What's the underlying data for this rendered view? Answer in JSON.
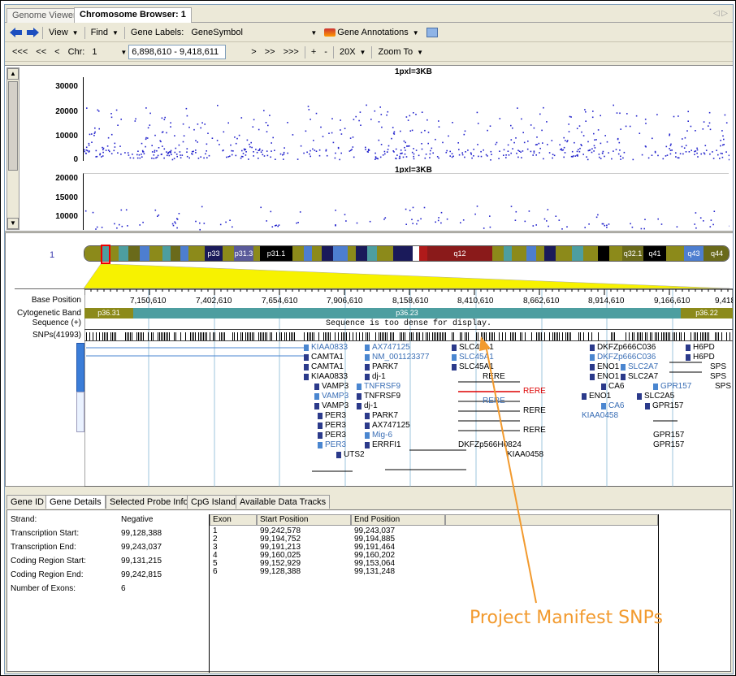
{
  "tabs": [
    {
      "label": "Genome Viewer"
    },
    {
      "label": "Chromosome Browser: 1"
    }
  ],
  "toolbar1": {
    "view_label": "View",
    "find_label": "Find",
    "gene_labels_label": "Gene Labels:",
    "gene_labels_value": "GeneSymbol",
    "gene_annotations_label": "Gene Annotations"
  },
  "toolbar2": {
    "nav_far_left": "<<<",
    "nav_more_left": "<<",
    "nav_left": "<",
    "chr_label": "Chr:",
    "chr_value": "1",
    "range_value": "6,898,610 - 9,418,611",
    "nav_right": ">",
    "nav_more_right": ">>",
    "nav_far_right": ">>>",
    "zoom_in": "+",
    "zoom_out": "-",
    "zoom_level": "20X",
    "zoom_to": "Zoom To"
  },
  "plots": [
    {
      "title": "1pxl=3KB",
      "y_ticks": [
        "30000",
        "20000",
        "10000",
        "0"
      ]
    },
    {
      "title": "1pxl=3KB",
      "y_ticks": [
        "20000",
        "15000",
        "10000"
      ]
    }
  ],
  "chromosome": {
    "number": "1",
    "bands": [
      "p33",
      "p31.3",
      "p31.1",
      "q12",
      "q32.1",
      "q41",
      "q43",
      "q44"
    ]
  },
  "tracks": {
    "base_position_label": "Base Position",
    "positions": [
      "7,150,610",
      "7,402,610",
      "7,654,610",
      "7,906,610",
      "8,158,610",
      "8,410,610",
      "8,662,610",
      "8,914,610",
      "9,166,610",
      "9,418"
    ],
    "cyto_label": "Cytogenetic Band",
    "cyto_bands": [
      "p36.31",
      "p36.23",
      "p36.22"
    ],
    "sequence_label": "Sequence (+)",
    "sequence_message": "Sequence is too dense for display.",
    "snps_label": "SNPs(41993)"
  },
  "genes": {
    "col1": [
      "KIAA0833",
      "CAMTA1",
      "CAMTA1",
      "KIAA0833",
      "VAMP3",
      "VAMP3",
      "VAMP3",
      "PER3",
      "PER3",
      "PER3",
      "PER3",
      "UTS2"
    ],
    "col2": [
      "AX747125",
      "NM_001123377",
      "PARK7",
      "dj-1",
      "TNFRSF9",
      "TNFRSF9",
      "dj-1",
      "PARK7",
      "AX747125",
      "Mig-6",
      "ERRFI1"
    ],
    "col3": [
      "SLC45A1",
      "SLC45A1",
      "SLC45A1",
      "RERE",
      "RERE",
      "RERE",
      "RERE",
      "RERE",
      "DKFZp566H0824",
      "KIAA0458"
    ],
    "col4": [
      "DKFZp666C036",
      "DKFZp666C036",
      "ENO1",
      "ENO1",
      "RERE",
      "ENO1",
      "RERE",
      "KIAA0458",
      "SLC2A5",
      "SLC2A5",
      "GPR157",
      "GPR157"
    ],
    "col5": [
      "SLC2A7",
      "SLC2A7",
      "CA6",
      "CA6",
      "SLC2A5",
      "GPR157",
      "GPR157"
    ],
    "col6": [
      "H6PD",
      "H6PD",
      "SPS",
      "SPS",
      "SPS"
    ]
  },
  "bottom_tabs": [
    "Gene ID",
    "Gene Details",
    "Selected Probe Info",
    "CpG Island",
    "Available Data Tracks"
  ],
  "details": [
    {
      "label": "Strand:",
      "value": "Negative"
    },
    {
      "label": "Transcription Start:",
      "value": "99,128,388"
    },
    {
      "label": "Transcription End:",
      "value": "99,243,037"
    },
    {
      "label": "Coding Region Start:",
      "value": "99,131,215"
    },
    {
      "label": "Coding Region End:",
      "value": "99,242,815"
    },
    {
      "label": "Number of Exons:",
      "value": "6"
    }
  ],
  "exon_table": {
    "headers": [
      "Exon",
      "Start Position",
      "End Position"
    ],
    "rows": [
      [
        "1",
        "99,242,578",
        "99,243,037"
      ],
      [
        "2",
        "99,194,752",
        "99,194,885"
      ],
      [
        "3",
        "99,191,213",
        "99,191,464"
      ],
      [
        "4",
        "99,160,025",
        "99,160,202"
      ],
      [
        "5",
        "99,152,929",
        "99,153,064"
      ],
      [
        "6",
        "99,128,388",
        "99,131,248"
      ]
    ]
  },
  "annotation": "Project Manifest SNPs",
  "colors": {
    "accent": "#f29a2e",
    "snp_dots": "#2222cc",
    "gene_dark": "#2b3a8b",
    "gene_blue": "#3a6eb5",
    "cyto": "#4d9ea0",
    "cyto_dark": "#8c8a1a"
  }
}
